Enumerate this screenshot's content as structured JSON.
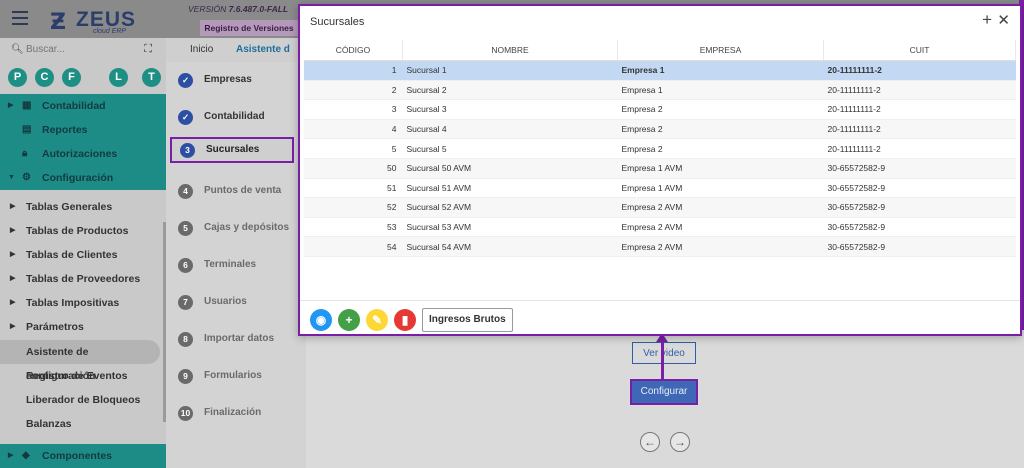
{
  "app": {
    "logo_name": "ZEUS",
    "logo_sub": "cloud ERP",
    "version_prefix": "VERSIÓN",
    "version": "7.6.487.0-FALL",
    "registro_label": "Registro de Versiones"
  },
  "sidebar": {
    "search_placeholder": "Buscar...",
    "favorites": [
      "P",
      "C",
      "F",
      "L",
      "T"
    ],
    "menu": [
      {
        "label": "Contabilidad"
      },
      {
        "label": "Reportes"
      },
      {
        "label": "Autorizaciones"
      },
      {
        "label": "Configuración"
      }
    ],
    "config_items": [
      {
        "label": "Tablas Generales"
      },
      {
        "label": "Tablas de Productos"
      },
      {
        "label": "Tablas de Clientes"
      },
      {
        "label": "Tablas de Proveedores"
      },
      {
        "label": "Tablas Impositivas"
      },
      {
        "label": "Parámetros"
      },
      {
        "label": "Asistente de configuración"
      },
      {
        "label": "Registro de Eventos"
      },
      {
        "label": "Liberador de Bloqueos"
      },
      {
        "label": "Balanzas"
      }
    ],
    "componentes": "Componentes"
  },
  "tabs": {
    "inicio": "Inicio",
    "asistente": "Asistente d"
  },
  "steps": [
    {
      "num": "✓",
      "label": "Empresas"
    },
    {
      "num": "✓",
      "label": "Contabilidad"
    },
    {
      "num": "3",
      "label": "Sucursales"
    },
    {
      "num": "4",
      "label": "Puntos de venta"
    },
    {
      "num": "5",
      "label": "Cajas y depósitos"
    },
    {
      "num": "6",
      "label": "Terminales"
    },
    {
      "num": "7",
      "label": "Usuarios"
    },
    {
      "num": "8",
      "label": "Importar datos"
    },
    {
      "num": "9",
      "label": "Formularios"
    },
    {
      "num": "10",
      "label": "Finalización"
    }
  ],
  "content": {
    "ver_video": "Ver video",
    "configurar": "Configurar"
  },
  "modal": {
    "title": "Sucursales",
    "columns": [
      "CÓDIGO",
      "NOMBRE",
      "EMPRESA",
      "CUIT"
    ],
    "rows": [
      [
        "1",
        "Sucursal 1",
        "Empresa 1",
        "20-11111111-2"
      ],
      [
        "2",
        "Sucursal 2",
        "Empresa 1",
        "20-11111111-2"
      ],
      [
        "3",
        "Sucursal 3",
        "Empresa 2",
        "20-11111111-2"
      ],
      [
        "4",
        "Sucursal 4",
        "Empresa 2",
        "20-11111111-2"
      ],
      [
        "5",
        "Sucursal 5",
        "Empresa 2",
        "20-11111111-2"
      ],
      [
        "50",
        "Sucursal 50 AVM",
        "Empresa 1 AVM",
        "30-65572582-9"
      ],
      [
        "51",
        "Sucursal 51 AVM",
        "Empresa 1 AVM",
        "30-65572582-9"
      ],
      [
        "52",
        "Sucursal 52 AVM",
        "Empresa 2 AVM",
        "30-65572582-9"
      ],
      [
        "53",
        "Sucursal 53 AVM",
        "Empresa 2 AVM",
        "30-65572582-9"
      ],
      [
        "54",
        "Sucursal 54 AVM",
        "Empresa 2 AVM",
        "30-65572582-9"
      ]
    ],
    "ingresos_label": "Ingresos Brutos"
  }
}
